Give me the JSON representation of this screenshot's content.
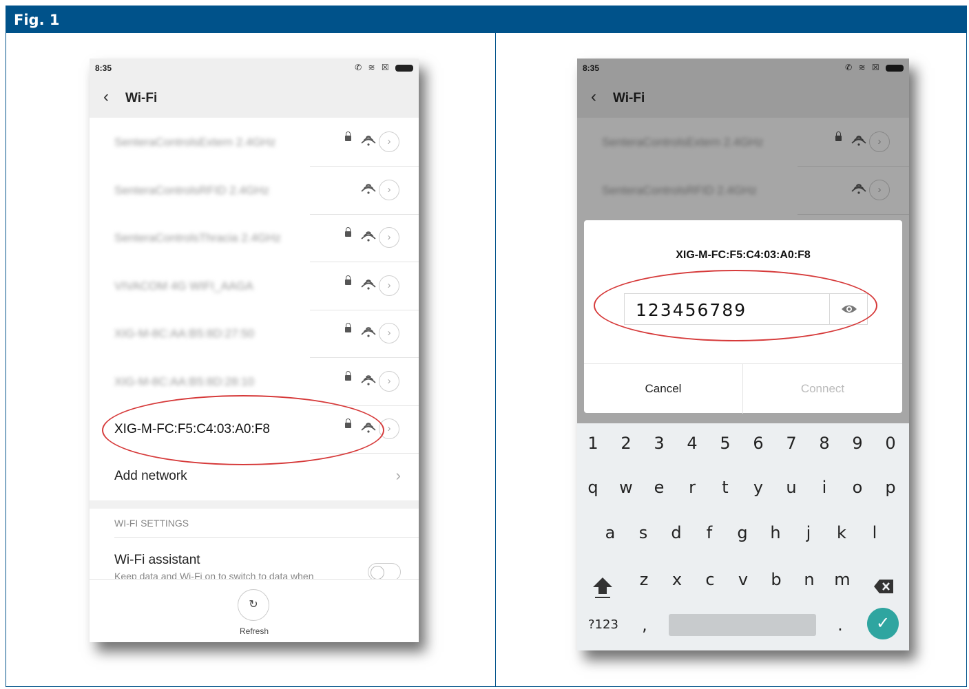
{
  "figure": {
    "title": "Fig. 1"
  },
  "left_phone": {
    "status": {
      "time": "8:35"
    },
    "screen_title": "Wi-Fi",
    "networks": [
      {
        "name": "SenteraControlsExtern 2.4GHz",
        "locked": true
      },
      {
        "name": "SenteraControlsRFID 2.4GHz",
        "locked": false
      },
      {
        "name": "SenteraControlsThracia 2.4GHz",
        "locked": true
      },
      {
        "name": "VIVACOM 4G WIFI_AAGA",
        "locked": true
      },
      {
        "name": "XIG-M-8C:AA:B5:8D:27:50",
        "locked": true
      },
      {
        "name": "XIG-M-8C:AA:B5:8D:28:10",
        "locked": true
      },
      {
        "name": "XIG-M-FC:F5:C4:03:A0:F8",
        "locked": true
      }
    ],
    "add_network": "Add network",
    "section_label": "WI-FI SETTINGS",
    "assistant": {
      "title": "Wi-Fi assistant",
      "description": "Keep data and Wi-Fi on to switch to data when"
    },
    "refresh_label": "Refresh"
  },
  "right_phone": {
    "status": {
      "time": "8:35"
    },
    "screen_title": "Wi-Fi",
    "networks": [
      {
        "name": "SenteraControlsExtern 2.4GHz",
        "locked": true
      },
      {
        "name": "SenteraControlsRFID 2.4GHz",
        "locked": false
      }
    ],
    "dialog": {
      "title": "XIG-M-FC:F5:C4:03:A0:F8",
      "password_value": "123456789",
      "cancel_label": "Cancel",
      "connect_label": "Connect"
    },
    "keyboard": {
      "row_numbers": [
        "1",
        "2",
        "3",
        "4",
        "5",
        "6",
        "7",
        "8",
        "9",
        "0"
      ],
      "row_top": [
        "q",
        "w",
        "e",
        "r",
        "t",
        "y",
        "u",
        "i",
        "o",
        "p"
      ],
      "row_home": [
        "a",
        "s",
        "d",
        "f",
        "g",
        "h",
        "j",
        "k",
        "l"
      ],
      "row_bottom": [
        "z",
        "x",
        "c",
        "v",
        "b",
        "n",
        "m"
      ],
      "symbols_label": "?123",
      "comma": ",",
      "period": "."
    }
  },
  "colors": {
    "header": "#00528a",
    "highlight": "#d63a3a",
    "done_key": "#2fa5a0"
  }
}
